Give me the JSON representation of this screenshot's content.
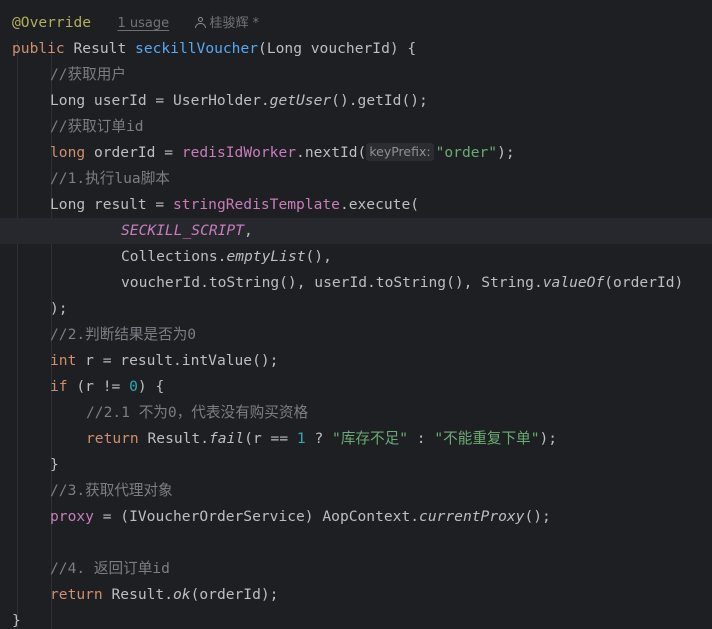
{
  "annotation": "@Override",
  "usage": "1 usage",
  "author": "桂骏辉 *",
  "sig": {
    "public": "public",
    "type": "Result",
    "method": "seckillVoucher",
    "open": "(",
    "params": "Long voucherId) {"
  },
  "c1": "//获取用户",
  "l1": {
    "decl": "Long userId = UserHolder.",
    "m": "getUser",
    "rest": "().getId();"
  },
  "c2": "//获取订单id",
  "l2": {
    "kw": "long",
    "mid": " orderId = ",
    "fld": "redisIdWorker",
    "call": ".nextId(",
    "hint": "keyPrefix:",
    "str": "\"order\"",
    "end": ");"
  },
  "c3": "//1.执行lua脚本",
  "l3": {
    "decl": "Long result = ",
    "fld": "stringRedisTemplate",
    "call": ".execute("
  },
  "l4": {
    "sf": "SECKILL_SCRIPT",
    "comma": ","
  },
  "l5": {
    "a": "Collections.",
    "m": "emptyList",
    "b": "(),"
  },
  "l6": {
    "a": "voucherId.toString(), userId.toString(), String.",
    "m": "valueOf",
    "b": "(orderId)"
  },
  "l7": ");",
  "c4": "//2.判断结果是否为0",
  "l8": {
    "kw": "int",
    "rest": " r = result.intValue();"
  },
  "l9": {
    "kw": "if",
    "a": " (r != ",
    "num": "0",
    "b": ") {"
  },
  "c5": "//2.1 不为0，代表没有购买资格",
  "l10": {
    "kw": "return",
    "a": " Result.",
    "m": "fail",
    "b": "(r == ",
    "num": "1",
    "c": " ? ",
    "s1": "\"库存不足\"",
    "d": " : ",
    "s2": "\"不能重复下单\"",
    "e": ");"
  },
  "l11": "}",
  "c6": "//3.获取代理对象",
  "l12": {
    "fld": "proxy",
    "a": " = (IVoucherOrderService) AopContext.",
    "m": "currentProxy",
    "b": "();"
  },
  "c7": "//4. 返回订单id",
  "l13": {
    "kw": "return",
    "a": " Result.",
    "m": "ok",
    "b": "(orderId);"
  },
  "l14": "}"
}
